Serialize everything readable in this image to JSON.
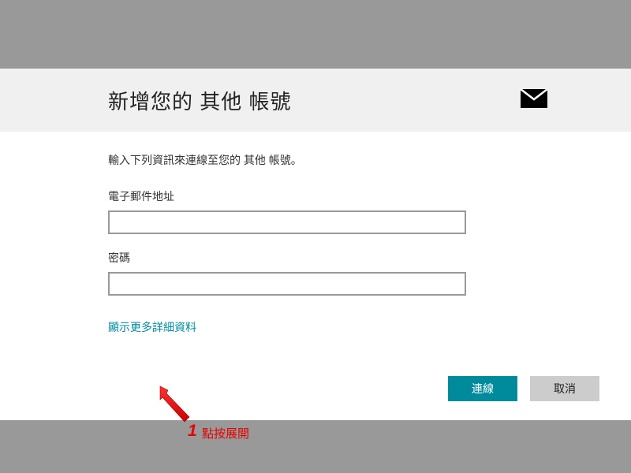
{
  "header": {
    "title": "新增您的 其他 帳號"
  },
  "content": {
    "instruction": "輸入下列資訊來連線至您的 其他 帳號。",
    "email_label": "電子郵件地址",
    "email_value": "",
    "password_label": "密碼",
    "password_value": "",
    "show_more": "顯示更多詳細資料"
  },
  "annotation": {
    "number": "1",
    "text": "點按展開"
  },
  "buttons": {
    "connect": "連線",
    "cancel": "取消"
  },
  "colors": {
    "accent": "#008b9c",
    "annotation": "#e60000",
    "background": "#999999"
  }
}
